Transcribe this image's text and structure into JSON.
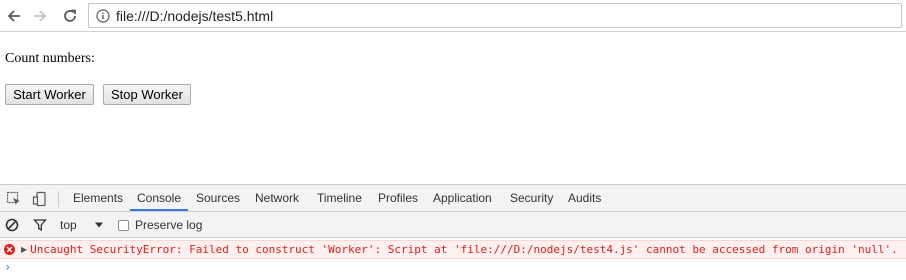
{
  "browser": {
    "url": "file:///D:/nodejs/test5.html",
    "icons": [
      "back-arrow-icon",
      "forward-arrow-icon",
      "reload-icon",
      "info-icon"
    ],
    "colors": {
      "toolbar_bg": "#ffffff",
      "border": "#c6c6c6"
    }
  },
  "page": {
    "count_label": "Count numbers:",
    "start_button": "Start Worker",
    "stop_button": "Stop Worker"
  },
  "devtools": {
    "tabs": [
      {
        "label": "Elements",
        "active": false
      },
      {
        "label": "Console",
        "active": true
      },
      {
        "label": "Sources",
        "active": false
      },
      {
        "label": "Network",
        "active": false
      },
      {
        "label": "Timeline",
        "active": false
      },
      {
        "label": "Profiles",
        "active": false
      },
      {
        "label": "Application",
        "active": false
      },
      {
        "label": "Security",
        "active": false
      },
      {
        "label": "Audits",
        "active": false
      }
    ],
    "filter": {
      "context": "top",
      "preserve_log_label": "Preserve log"
    },
    "console": {
      "error_message": "Uncaught SecurityError: Failed to construct 'Worker': Script at 'file:///D:/nodejs/test4.js' cannot be accessed from origin 'null'.",
      "prompt": "›"
    },
    "colors": {
      "active_tab": "#3879d9",
      "error": "#e0201c",
      "error_bg": "#fff0f0",
      "prompt": "#367cf1"
    }
  }
}
